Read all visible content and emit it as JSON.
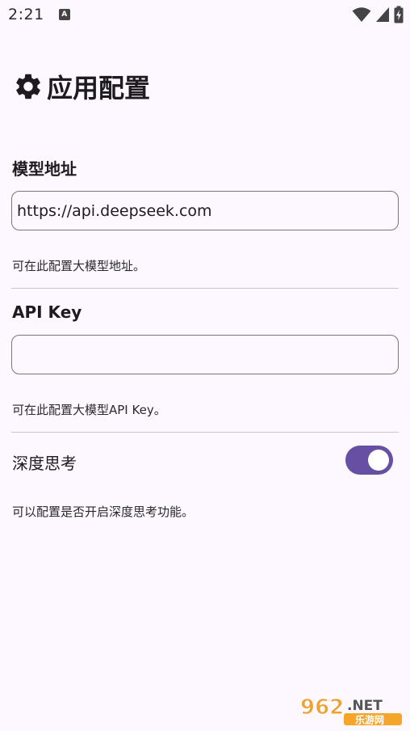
{
  "status_bar": {
    "time": "2:21",
    "notification_icon": "A"
  },
  "header": {
    "title": "应用配置",
    "icon": "gear-icon"
  },
  "model_address": {
    "label": "模型地址",
    "value": "https://api.deepseek.com",
    "helper": "可在此配置大模型地址。"
  },
  "api_key": {
    "label": "API Key",
    "value": "",
    "helper": "可在此配置大模型API Key。"
  },
  "deep_thinking": {
    "label": "深度思考",
    "enabled": true,
    "helper": "可以配置是否开启深度思考功能。"
  },
  "watermark": {
    "brand": "962.NET",
    "sub": "乐游网"
  },
  "colors": {
    "background": "#fdf7ff",
    "accent": "#6750a4",
    "outline": "#79747e",
    "divider": "#cac4d0"
  }
}
